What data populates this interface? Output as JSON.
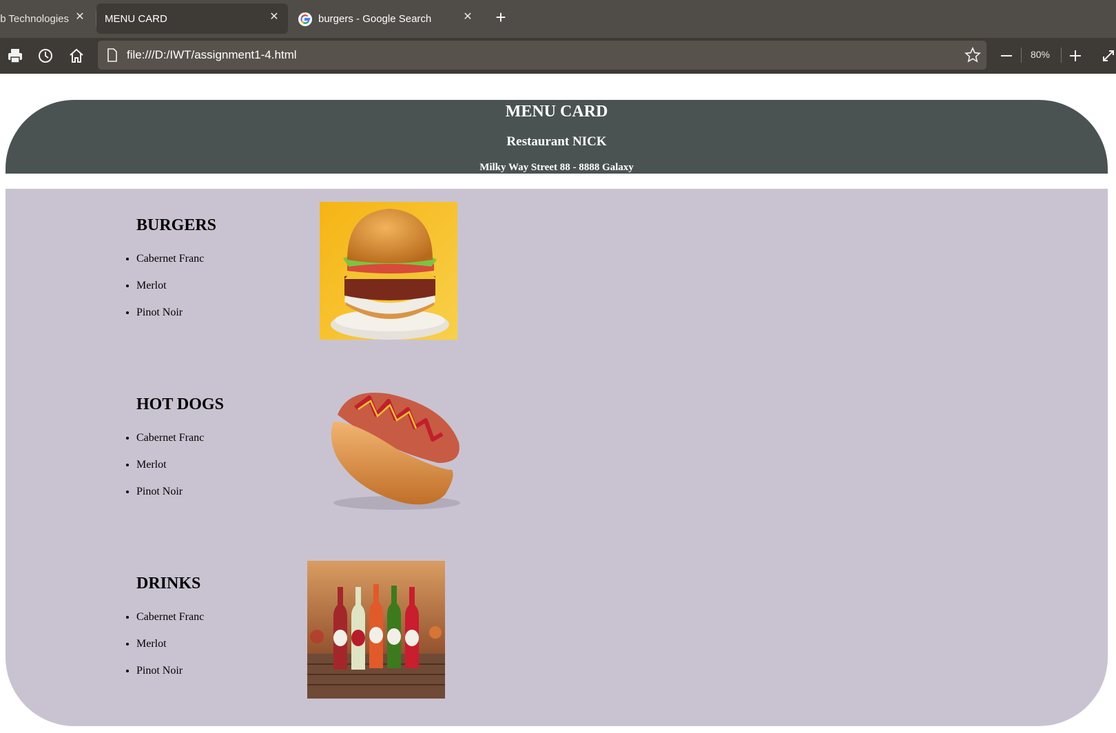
{
  "browser": {
    "tabs": [
      {
        "label": "Web Technologies",
        "active": false
      },
      {
        "label": "MENU CARD",
        "active": true
      },
      {
        "label": "burgers - Google Search",
        "active": false,
        "icon": "google-icon"
      }
    ],
    "url": "file:///D:/IWT/assignment1-4.html",
    "zoom": "80%",
    "toolbar_icons": [
      "print-icon",
      "history-icon",
      "home-icon",
      "favorite-star-icon",
      "zoom-out-icon",
      "zoom-in-icon",
      "fullscreen-icon"
    ]
  },
  "header": {
    "title": "MENU CARD",
    "restaurant": "Restaurant NICK",
    "address": "Milky Way Street 88 - 8888 Galaxy"
  },
  "sections": [
    {
      "heading": "BURGERS",
      "items": [
        "Cabernet Franc",
        "Merlot",
        "Pinot Noir"
      ],
      "image": "burger-photo"
    },
    {
      "heading": "HOT DOGS",
      "items": [
        "Cabernet Franc",
        "Merlot",
        "Pinot Noir"
      ],
      "image": "hotdog-photo"
    },
    {
      "heading": "DRINKS",
      "items": [
        "Cabernet Franc",
        "Merlot",
        "Pinot Noir"
      ],
      "image": "drinks-photo"
    }
  ],
  "colors": {
    "header_bg": "#4a5352",
    "body_bg": "#c9c3d1",
    "tabbar_bg": "#504c47",
    "toolbar_bg": "#3e3b37"
  }
}
